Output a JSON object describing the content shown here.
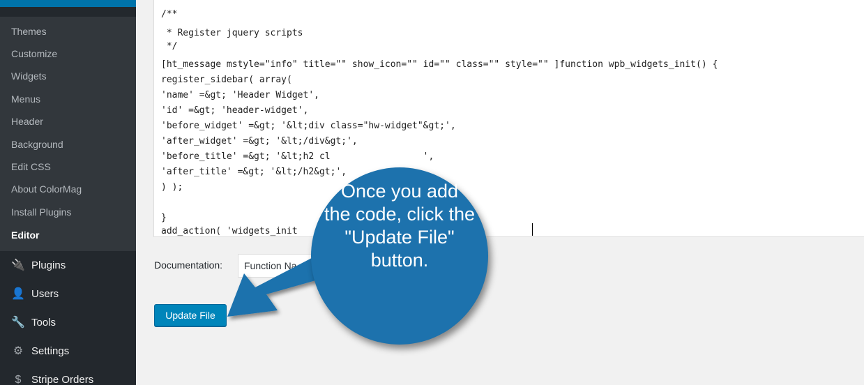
{
  "sidebar": {
    "submenu": [
      "Themes",
      "Customize",
      "Widgets",
      "Menus",
      "Header",
      "Background",
      "Edit CSS",
      "About ColorMag",
      "Install Plugins",
      "Editor"
    ],
    "menu": [
      {
        "label": "Plugins",
        "icon": "plugins-icon"
      },
      {
        "label": "Users",
        "icon": "users-icon"
      },
      {
        "label": "Tools",
        "icon": "tools-icon"
      },
      {
        "label": "Settings",
        "icon": "settings-icon"
      },
      {
        "label": "Stripe Orders",
        "icon": "stripe-icon"
      }
    ]
  },
  "editor": {
    "lines": [
      "/**",
      " * Register jquery scripts",
      " */",
      "[ht_message mstyle=\"info\" title=\"\" show_icon=\"\" id=\"\" class=\"\" style=\"\" ]function wpb_widgets_init() {",
      "register_sidebar( array(",
      "'name' =&gt; 'Header Widget',",
      "'id' =&gt; 'header-widget',",
      "'before_widget' =&gt; '&lt;div class=\"hw-widget\"&gt;',",
      "'after_widget' =&gt; '&lt;/div&gt;',",
      "'before_title' =&gt; '&lt;h2 cl                 ',",
      "'after_title' =&gt; '&lt;/h2&gt;',",
      ") );",
      "",
      "}",
      "add_action( 'widgets_init                       essage]"
    ]
  },
  "documentation": {
    "label": "Documentation:",
    "select_value": "Function Na"
  },
  "update_button": "Update File",
  "callout": {
    "lines": [
      "Once you add",
      "the code, click the",
      "\"Update File\"",
      "button."
    ]
  },
  "colors": {
    "accent": "#0085ba",
    "callout": "#1d72ad",
    "sidebar": "#23282d"
  }
}
